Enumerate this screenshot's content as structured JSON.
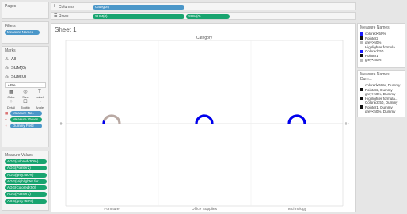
{
  "pages": {
    "title": "Pages"
  },
  "filters": {
    "title": "Filters",
    "pill": "Measure Names"
  },
  "marks": {
    "title": "Marks",
    "cards": [
      {
        "icon": "⁂",
        "label": "All"
      },
      {
        "icon": "⁂",
        "label": "SUM(0)"
      },
      {
        "icon": "⁂",
        "label": "SUM(0)"
      }
    ],
    "type": "Pie",
    "buttons": [
      {
        "icon": "▦",
        "label": "Color"
      },
      {
        "icon": "◎",
        "label": "Size"
      },
      {
        "icon": "T",
        "label": "Label"
      },
      {
        "icon": "⁘",
        "label": "Detail"
      },
      {
        "icon": "☐",
        "label": "Tooltip"
      },
      {
        "icon": "◔",
        "label": "Angle"
      }
    ],
    "pills": [
      "Measure Na..",
      "Measure Values",
      "Dummy Field"
    ]
  },
  "measure_values": {
    "title": "Measure Values",
    "pills": [
      "AGG(colored<50%)",
      "AGG(Pointer2)",
      "AGG(grey>50%)",
      "AGG(Highlighter for...",
      "AGG(Colored<50)",
      "AGG(Pointer1)",
      "AGG(grey<50%)"
    ]
  },
  "shelves": {
    "columns_label": "Columns",
    "columns_pill": "Category",
    "rows_label": "Rows",
    "rows_pills": [
      "SUM(0)",
      "SUM(0)"
    ]
  },
  "sheet": {
    "title": "Sheet 1",
    "header": "Category",
    "left_tick": "0",
    "right_tick": "0",
    "categories": [
      "Furniture",
      "Office Supplies",
      "Technology"
    ]
  },
  "colors": {
    "blue": "#0000ee",
    "grey": "#b9a9a3",
    "pill_blue": "#4b97c9",
    "pill_green": "#18a46f"
  },
  "legend1": {
    "title": "Measure Names",
    "items": [
      {
        "label": "colored<50%",
        "color": "#1a1aff"
      },
      {
        "label": "Pointer2",
        "color": "#111111"
      },
      {
        "label": "grey>50%",
        "color": "#bbbbbb"
      },
      {
        "label": "Highlighter formula",
        "color": ""
      },
      {
        "label": "Colored<50",
        "color": "#1a1aff"
      },
      {
        "label": "Pointer1",
        "color": "#111111"
      },
      {
        "label": "grey<50%",
        "color": "#bbbbbb"
      }
    ]
  },
  "legend2": {
    "title": "Measure Names, Dum...",
    "items": [
      {
        "label": "colored<50%, Dummy",
        "color": ""
      },
      {
        "label": "Pointer2, Dummy",
        "color": "#111111"
      },
      {
        "label": "grey>50%, Dummy",
        "color": ""
      },
      {
        "label": "Highlighter formula...",
        "color": "#111111"
      },
      {
        "label": "Colored<50, Dummy",
        "color": ""
      },
      {
        "label": "Pointer1, Dummy",
        "color": "#111111"
      },
      {
        "label": "grey<50%, Dummy",
        "color": ""
      }
    ]
  }
}
